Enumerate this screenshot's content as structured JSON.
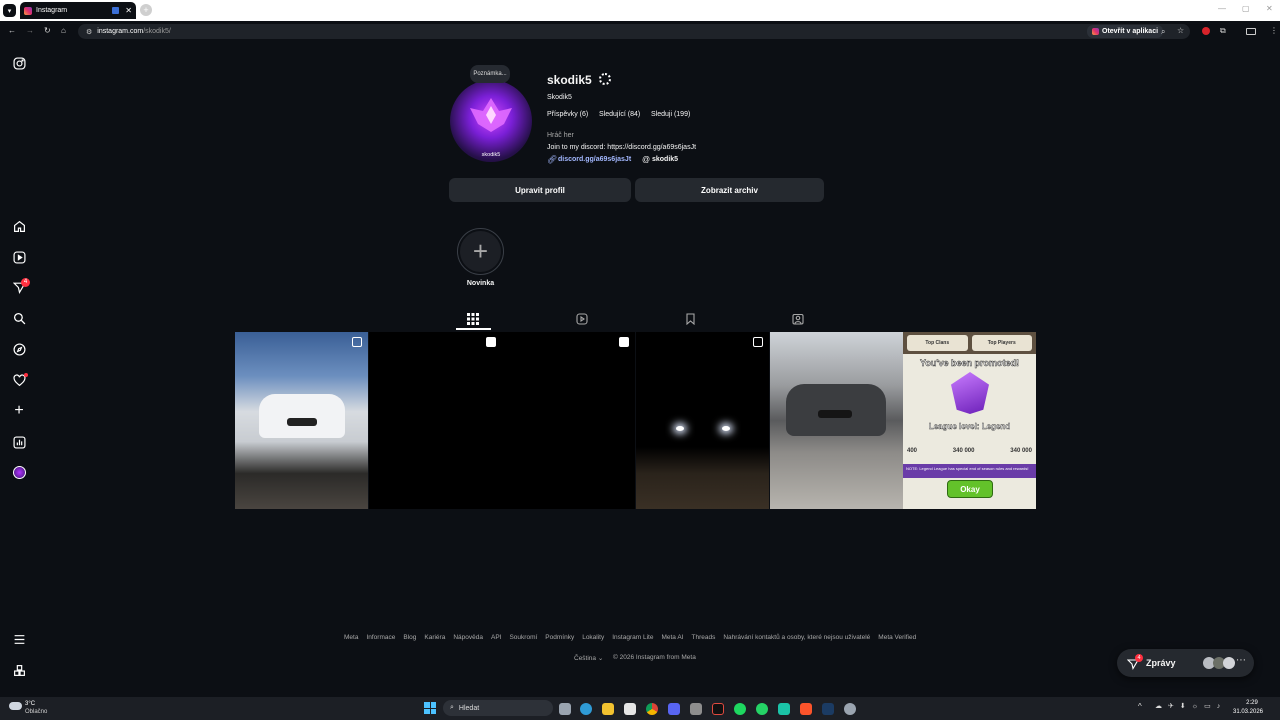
{
  "browser": {
    "tab_title": "Instagram",
    "url_host": "instagram.com",
    "url_path": "/skodik5/",
    "open_in_app": "Otevřít v aplikaci"
  },
  "profile": {
    "note": "Poznámka...",
    "username": "skodik5",
    "display_name": "Skodik5",
    "posts": "Příspěvky (6)",
    "followers": "Sledující (84)",
    "following": "Sleduji (199)",
    "category": "Hráč her",
    "bio": "Join to my discord: https://discord.gg/a69s6jasJt",
    "link": "discord.gg/a69s6jasJt",
    "threads": "skodik5",
    "avatar_label": "skodik5",
    "edit_button": "Upravit profil",
    "archive_button": "Zobrazit archiv",
    "highlight_new": "Novinka"
  },
  "sidebar_badge": "4",
  "posts": {
    "coc_tabs": [
      "Top Clans",
      "Top Players"
    ],
    "coc_title": "You've been promoted!",
    "coc_league": "League level: Legend",
    "coc_values": [
      "400",
      "340 000",
      "340 000"
    ],
    "coc_note": "NOTE: Legend League has special end of season rules and rewards!",
    "coc_button": "Okay"
  },
  "footer": {
    "links": [
      "Meta",
      "Informace",
      "Blog",
      "Kariéra",
      "Nápověda",
      "API",
      "Soukromí",
      "Podmínky",
      "Lokality",
      "Instagram Lite",
      "Meta AI",
      "Threads",
      "Nahrávání kontaktů a osoby, které nejsou uživatelé",
      "Meta Verified"
    ],
    "language": "Čeština",
    "copyright": "© 2026 Instagram from Meta"
  },
  "messages": {
    "label": "Zprávy",
    "badge": "4"
  },
  "taskbar": {
    "weather_temp": "3°C",
    "weather_desc": "Oblačno",
    "search": "Hledat",
    "time": "2:29",
    "date": "31.03.2026"
  },
  "colors": {
    "background": "#0c0f14",
    "button": "#25292f",
    "link": "#a3b8ff",
    "badge": "#ff3040"
  }
}
